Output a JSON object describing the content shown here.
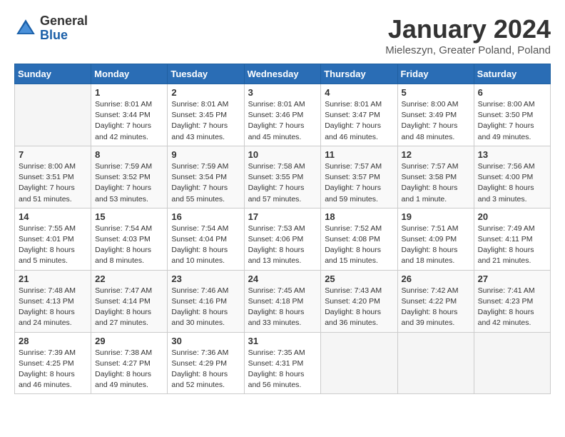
{
  "header": {
    "title": "January 2024",
    "location": "Mieleszyn, Greater Poland, Poland",
    "logo_general": "General",
    "logo_blue": "Blue"
  },
  "days_of_week": [
    "Sunday",
    "Monday",
    "Tuesday",
    "Wednesday",
    "Thursday",
    "Friday",
    "Saturday"
  ],
  "weeks": [
    [
      {
        "day": "",
        "info": ""
      },
      {
        "day": "1",
        "info": "Sunrise: 8:01 AM\nSunset: 3:44 PM\nDaylight: 7 hours\nand 42 minutes."
      },
      {
        "day": "2",
        "info": "Sunrise: 8:01 AM\nSunset: 3:45 PM\nDaylight: 7 hours\nand 43 minutes."
      },
      {
        "day": "3",
        "info": "Sunrise: 8:01 AM\nSunset: 3:46 PM\nDaylight: 7 hours\nand 45 minutes."
      },
      {
        "day": "4",
        "info": "Sunrise: 8:01 AM\nSunset: 3:47 PM\nDaylight: 7 hours\nand 46 minutes."
      },
      {
        "day": "5",
        "info": "Sunrise: 8:00 AM\nSunset: 3:49 PM\nDaylight: 7 hours\nand 48 minutes."
      },
      {
        "day": "6",
        "info": "Sunrise: 8:00 AM\nSunset: 3:50 PM\nDaylight: 7 hours\nand 49 minutes."
      }
    ],
    [
      {
        "day": "7",
        "info": "Sunrise: 8:00 AM\nSunset: 3:51 PM\nDaylight: 7 hours\nand 51 minutes."
      },
      {
        "day": "8",
        "info": "Sunrise: 7:59 AM\nSunset: 3:52 PM\nDaylight: 7 hours\nand 53 minutes."
      },
      {
        "day": "9",
        "info": "Sunrise: 7:59 AM\nSunset: 3:54 PM\nDaylight: 7 hours\nand 55 minutes."
      },
      {
        "day": "10",
        "info": "Sunrise: 7:58 AM\nSunset: 3:55 PM\nDaylight: 7 hours\nand 57 minutes."
      },
      {
        "day": "11",
        "info": "Sunrise: 7:57 AM\nSunset: 3:57 PM\nDaylight: 7 hours\nand 59 minutes."
      },
      {
        "day": "12",
        "info": "Sunrise: 7:57 AM\nSunset: 3:58 PM\nDaylight: 8 hours\nand 1 minute."
      },
      {
        "day": "13",
        "info": "Sunrise: 7:56 AM\nSunset: 4:00 PM\nDaylight: 8 hours\nand 3 minutes."
      }
    ],
    [
      {
        "day": "14",
        "info": "Sunrise: 7:55 AM\nSunset: 4:01 PM\nDaylight: 8 hours\nand 5 minutes."
      },
      {
        "day": "15",
        "info": "Sunrise: 7:54 AM\nSunset: 4:03 PM\nDaylight: 8 hours\nand 8 minutes."
      },
      {
        "day": "16",
        "info": "Sunrise: 7:54 AM\nSunset: 4:04 PM\nDaylight: 8 hours\nand 10 minutes."
      },
      {
        "day": "17",
        "info": "Sunrise: 7:53 AM\nSunset: 4:06 PM\nDaylight: 8 hours\nand 13 minutes."
      },
      {
        "day": "18",
        "info": "Sunrise: 7:52 AM\nSunset: 4:08 PM\nDaylight: 8 hours\nand 15 minutes."
      },
      {
        "day": "19",
        "info": "Sunrise: 7:51 AM\nSunset: 4:09 PM\nDaylight: 8 hours\nand 18 minutes."
      },
      {
        "day": "20",
        "info": "Sunrise: 7:49 AM\nSunset: 4:11 PM\nDaylight: 8 hours\nand 21 minutes."
      }
    ],
    [
      {
        "day": "21",
        "info": "Sunrise: 7:48 AM\nSunset: 4:13 PM\nDaylight: 8 hours\nand 24 minutes."
      },
      {
        "day": "22",
        "info": "Sunrise: 7:47 AM\nSunset: 4:14 PM\nDaylight: 8 hours\nand 27 minutes."
      },
      {
        "day": "23",
        "info": "Sunrise: 7:46 AM\nSunset: 4:16 PM\nDaylight: 8 hours\nand 30 minutes."
      },
      {
        "day": "24",
        "info": "Sunrise: 7:45 AM\nSunset: 4:18 PM\nDaylight: 8 hours\nand 33 minutes."
      },
      {
        "day": "25",
        "info": "Sunrise: 7:43 AM\nSunset: 4:20 PM\nDaylight: 8 hours\nand 36 minutes."
      },
      {
        "day": "26",
        "info": "Sunrise: 7:42 AM\nSunset: 4:22 PM\nDaylight: 8 hours\nand 39 minutes."
      },
      {
        "day": "27",
        "info": "Sunrise: 7:41 AM\nSunset: 4:23 PM\nDaylight: 8 hours\nand 42 minutes."
      }
    ],
    [
      {
        "day": "28",
        "info": "Sunrise: 7:39 AM\nSunset: 4:25 PM\nDaylight: 8 hours\nand 46 minutes."
      },
      {
        "day": "29",
        "info": "Sunrise: 7:38 AM\nSunset: 4:27 PM\nDaylight: 8 hours\nand 49 minutes."
      },
      {
        "day": "30",
        "info": "Sunrise: 7:36 AM\nSunset: 4:29 PM\nDaylight: 8 hours\nand 52 minutes."
      },
      {
        "day": "31",
        "info": "Sunrise: 7:35 AM\nSunset: 4:31 PM\nDaylight: 8 hours\nand 56 minutes."
      },
      {
        "day": "",
        "info": ""
      },
      {
        "day": "",
        "info": ""
      },
      {
        "day": "",
        "info": ""
      }
    ]
  ]
}
